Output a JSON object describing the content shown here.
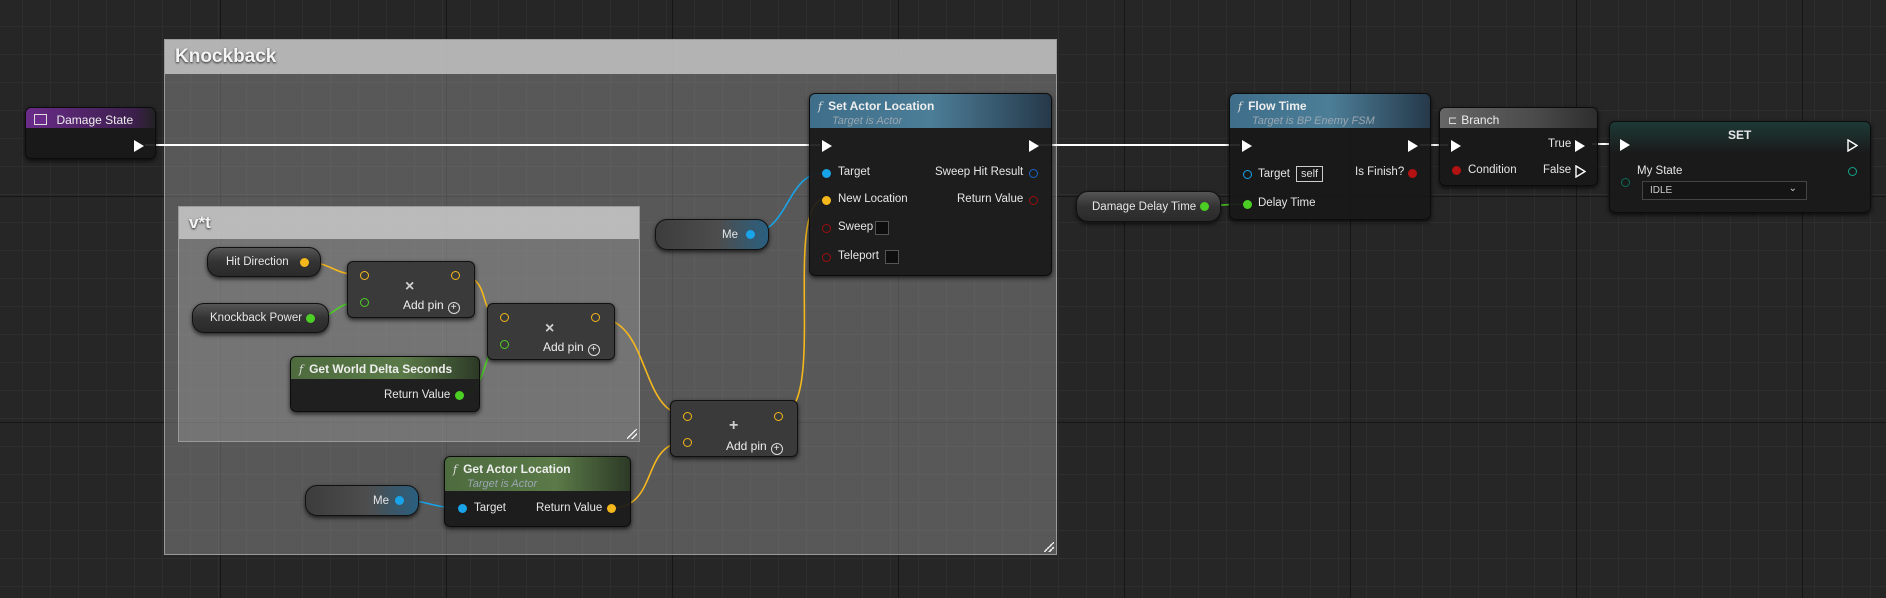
{
  "comments": {
    "knockback": "Knockback",
    "vt": "v*t"
  },
  "nodes": {
    "damage_state": {
      "title": "Damage State"
    },
    "hit_direction": {
      "label": "Hit Direction"
    },
    "knockback_power": {
      "label": "Knockback Power"
    },
    "get_world_delta": {
      "title": "Get World Delta Seconds",
      "return_value": "Return Value"
    },
    "multiply_1": {
      "op": "×",
      "add_pin": "Add pin"
    },
    "multiply_2": {
      "op": "×",
      "add_pin": "Add pin"
    },
    "add_node": {
      "op": "+",
      "add_pin": "Add pin"
    },
    "me_top": {
      "label": "Me"
    },
    "me_bottom": {
      "label": "Me"
    },
    "get_actor_location": {
      "title": "Get Actor Location",
      "subtitle": "Target is Actor",
      "target": "Target",
      "return_value": "Return Value"
    },
    "set_actor_location": {
      "title": "Set Actor Location",
      "subtitle": "Target is Actor",
      "target": "Target",
      "new_location": "New Location",
      "sweep": "Sweep",
      "teleport": "Teleport",
      "sweep_hit_result": "Sweep Hit Result",
      "return_value": "Return Value"
    },
    "damage_delay_time": {
      "label": "Damage Delay Time"
    },
    "flow_time": {
      "title": "Flow Time",
      "subtitle": "Target is BP Enemy FSM",
      "target": "Target",
      "self": "self",
      "delay_time": "Delay Time",
      "is_finish": "Is Finish?"
    },
    "branch": {
      "title": "Branch",
      "condition": "Condition",
      "true": "True",
      "false": "False"
    },
    "set": {
      "title": "SET",
      "my_state": "My State",
      "state_value": "IDLE"
    }
  },
  "colors": {
    "exec": "#ffffff",
    "vector_pin": "#f5b81c",
    "float_pin": "#4ccf24",
    "object_pin": "#19a3e8",
    "bool_pin": "#9a0e0e",
    "byte_pin": "#0d6b5a",
    "function_header_blue": "#3e6e8a",
    "function_header_green": "#4d6b3e",
    "variable_purple": "#6a2b8a"
  }
}
